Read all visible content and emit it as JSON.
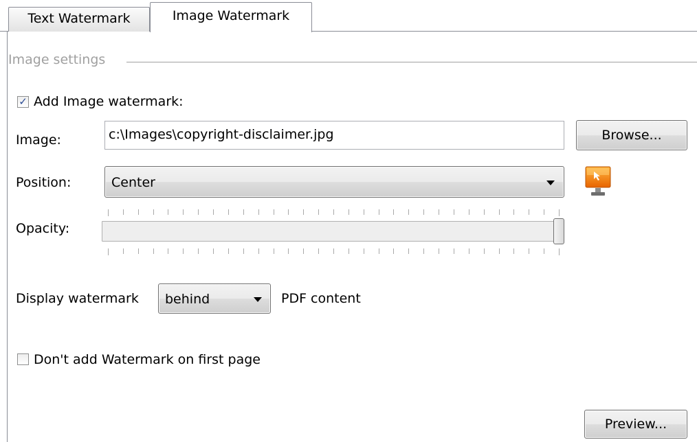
{
  "tabs": [
    {
      "label": "Text Watermark",
      "selected": false
    },
    {
      "label": "Image Watermark",
      "selected": true
    }
  ],
  "group": {
    "legend": "Image settings"
  },
  "add_image": {
    "label": "Add Image watermark:",
    "checked": true
  },
  "image": {
    "label": "Image:",
    "value": "c:\\Images\\copyright-disclaimer.jpg",
    "browse_label": "Browse..."
  },
  "position": {
    "label": "Position:",
    "selected": "Center",
    "preview_icon": "monitor-arrow-icon"
  },
  "opacity": {
    "label": "Opacity:",
    "value_fraction": 1.0
  },
  "display": {
    "prefix": "Display watermark",
    "selected": "behind",
    "suffix": "PDF content"
  },
  "first_page": {
    "label": "Don't add Watermark on first page",
    "checked": false
  },
  "preview_button": {
    "label": "Preview..."
  },
  "colors": {
    "accent": "#ff8a00",
    "check": "#2a4a94"
  }
}
